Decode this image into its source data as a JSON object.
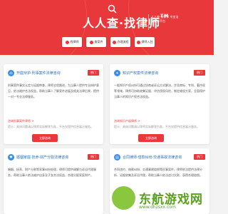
{
  "header": {
    "brand": "人人查·找律师",
    "brand_sup": "TM",
    "slogan": "人人查·找律师 专业法律服务平台"
  },
  "nav": [
    {
      "label": "找律师",
      "icon": "person-icon"
    },
    {
      "label": "查案件",
      "icon": "search-icon"
    },
    {
      "label": "办理流程",
      "icon": "list-icon"
    },
    {
      "label": "律师入驻",
      "icon": "user-plus-icon"
    }
  ],
  "cards": [
    {
      "title": "开庭辩护·刑事案件法律咨询",
      "badge": "热门",
      "icon": "scale-icon",
      "body": "刑事案件事实认定与证据审查，律师全程跟进，为当事人提供专业辩护意见，依法维护合法权益，帮助当事人了解案件进展及相关法律后果，提供一对一专业法律服务。",
      "link": "咨询刑事案件律师 >",
      "foot": "提示：具体问题请以律师实际解答为准，平台仅提供信息展示服务。",
      "button": "立即咨询"
    },
    {
      "title": "知识产权案件法律咨询",
      "badge": "热门",
      "icon": "bulb-icon",
      "body": "一般知识产权纠纷可通过协商或诉讼方式解决，涉及商标、专利、著作权等领域，律师可协助收集证据、评估侵权风险，制定维权方案，全面保护当事人的知识产权合法权益。",
      "link": "咨询知识产权律师 >",
      "foot": "提示：具体问题请以律师实际解答为准，平台仅提供信息展示服务。",
      "button": "立即咨询"
    },
    {
      "title": "婚姻家庭·抚养·财产分割法律咨询",
      "badge": "热门",
      "icon": "heart-icon",
      "body": "婚姻、抚养、财产分割等家事纠纷处理，律师可提供调解与诉讼代理服务，帮助当事人依法维护自身及子女合法权益，合理分配家庭财产。",
      "link": "",
      "foot": "",
      "button": "立即咨询"
    },
    {
      "title": "合同律师·借款纠纷·交通事故法律咨询",
      "badge": "热门",
      "icon": "doc-icon",
      "body": "合同违约、借款纠纷、交通事故赔偿等民事案件，律师依法提供法律分析、证据收集及诉讼代理，帮助当事人依法追讨欠款、获得合理赔偿。",
      "link": "",
      "foot": "",
      "button": "立即咨询"
    }
  ],
  "watermark": {
    "text": "东航游戏网",
    "sub": "www.dhzsxx.com"
  }
}
